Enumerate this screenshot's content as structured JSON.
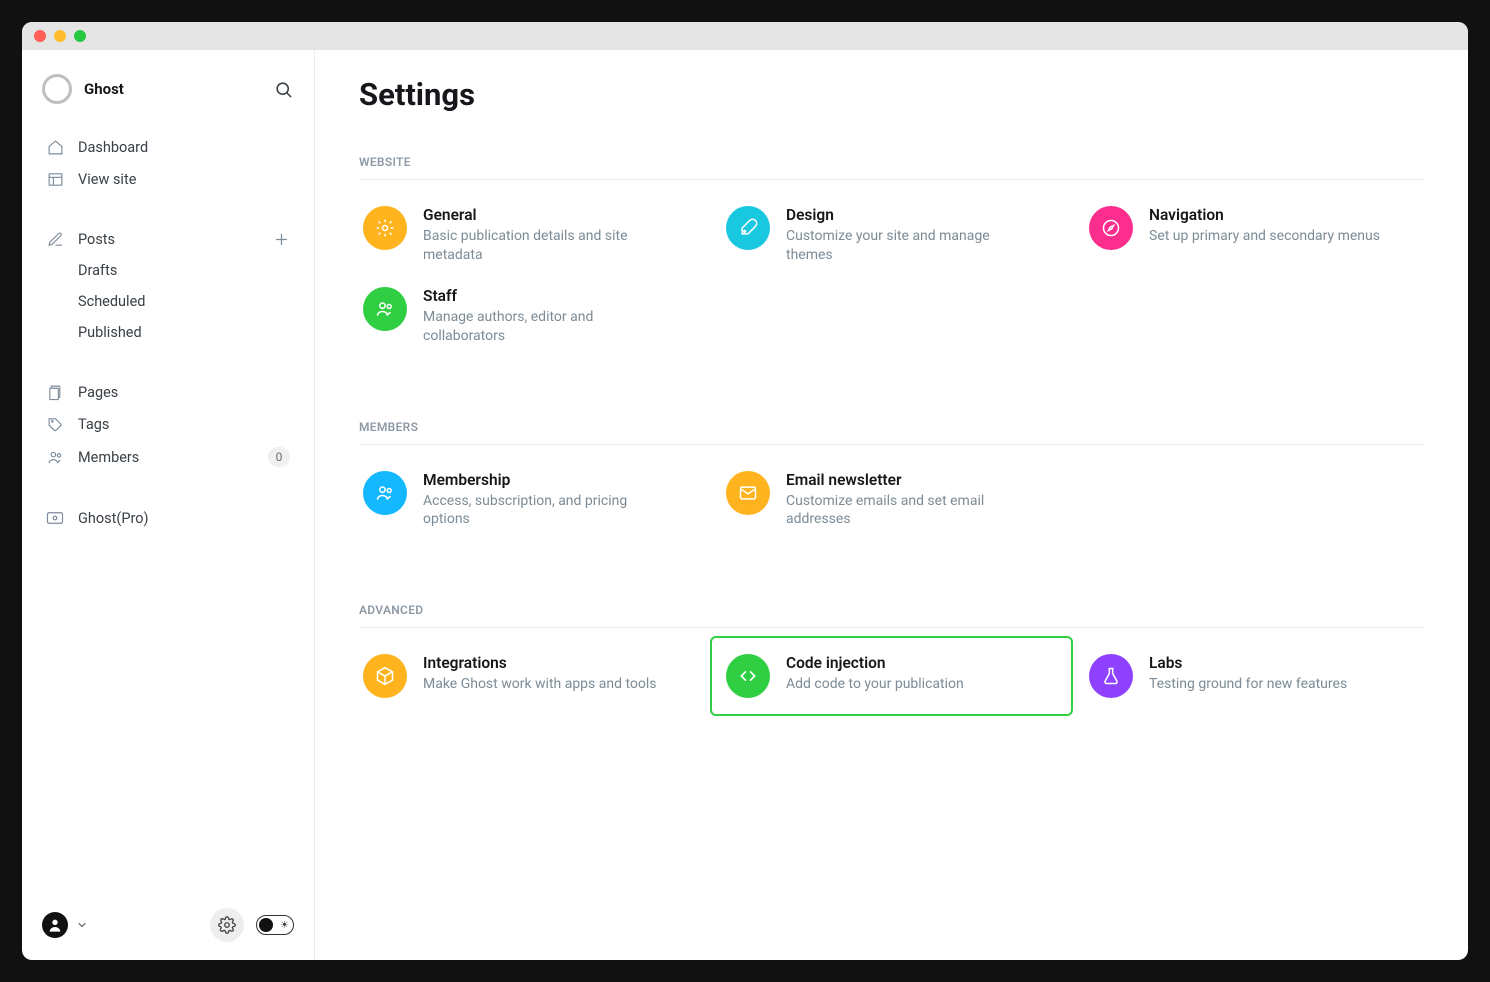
{
  "brand": {
    "name": "Ghost"
  },
  "sidebar": {
    "dashboard": "Dashboard",
    "view_site": "View site",
    "posts": "Posts",
    "drafts": "Drafts",
    "scheduled": "Scheduled",
    "published": "Published",
    "pages": "Pages",
    "tags": "Tags",
    "members": "Members",
    "members_count": "0",
    "ghost_pro": "Ghost(Pro)"
  },
  "page": {
    "title": "Settings"
  },
  "sections": {
    "website": {
      "label": "WEBSITE",
      "general": {
        "title": "General",
        "desc": "Basic publication details and site metadata"
      },
      "design": {
        "title": "Design",
        "desc": "Customize your site and manage themes"
      },
      "navigation": {
        "title": "Navigation",
        "desc": "Set up primary and secondary menus"
      },
      "staff": {
        "title": "Staff",
        "desc": "Manage authors, editor and collaborators"
      }
    },
    "members": {
      "label": "MEMBERS",
      "membership": {
        "title": "Membership",
        "desc": "Access, subscription, and pricing options"
      },
      "email": {
        "title": "Email newsletter",
        "desc": "Customize emails and set email addresses"
      }
    },
    "advanced": {
      "label": "ADVANCED",
      "integrations": {
        "title": "Integrations",
        "desc": "Make Ghost work with apps and tools"
      },
      "code": {
        "title": "Code injection",
        "desc": "Add code to your publication"
      },
      "labs": {
        "title": "Labs",
        "desc": "Testing ground for new features"
      }
    }
  }
}
